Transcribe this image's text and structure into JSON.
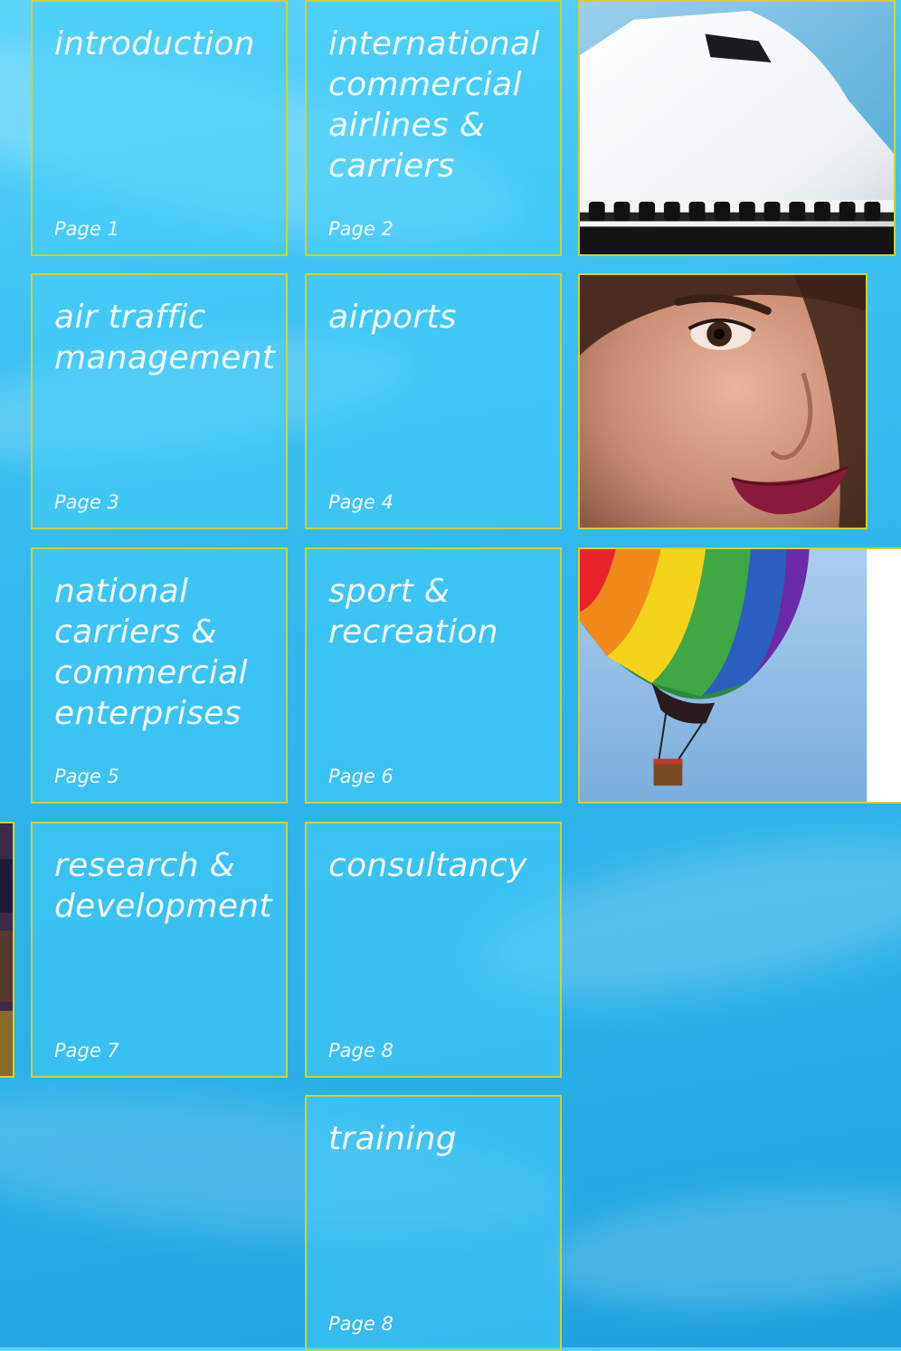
{
  "tiles": [
    {
      "title": "introduction",
      "page": "Page 1"
    },
    {
      "title": "international commercial airlines & carriers",
      "page": "Page 2"
    },
    {
      "title": "air traffic management",
      "page": "Page 3"
    },
    {
      "title": "airports",
      "page": "Page 4"
    },
    {
      "title": "national carriers & commercial enterprises",
      "page": "Page 5"
    },
    {
      "title": "sport & recreation",
      "page": "Page 6"
    },
    {
      "title": "research & development",
      "page": "Page 7"
    },
    {
      "title": "consultancy",
      "page": "Page 8"
    },
    {
      "title": "training",
      "page": "Page 8"
    }
  ],
  "colors": {
    "border": "#d4d12a",
    "background": "#2fb6ec",
    "text": "#f2fbff"
  },
  "icons": {
    "airplane_photo": "airplane-nose-photo-icon",
    "face_photo": "smiling-woman-photo-icon",
    "balloon_photo": "hot-air-balloon-photo-icon",
    "partial_photo": "partial-person-photo-icon"
  }
}
